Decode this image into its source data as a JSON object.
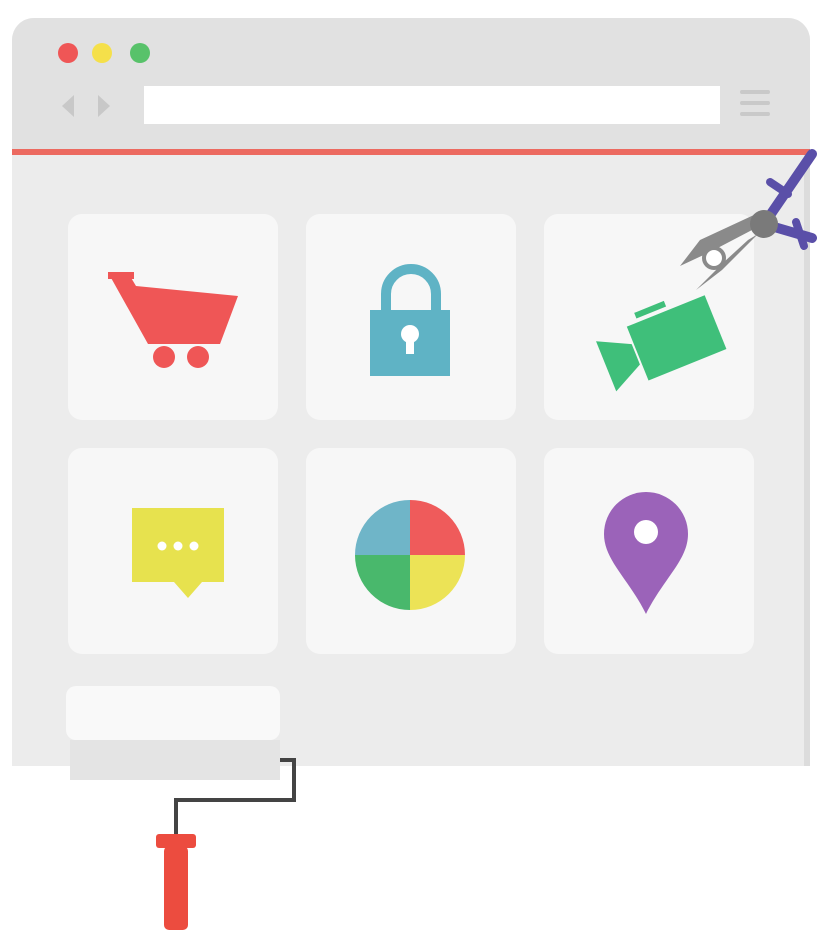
{
  "window": {
    "traffic_lights": [
      {
        "name": "close",
        "color": "#ef5656"
      },
      {
        "name": "minimize",
        "color": "#f5e04a"
      },
      {
        "name": "maximize",
        "color": "#58c26a"
      }
    ],
    "address_bar": {
      "value": "",
      "placeholder": ""
    },
    "accent_color": "#ec6a60"
  },
  "tiles": [
    {
      "icon": "shopping-cart-icon",
      "color": "#ef5656"
    },
    {
      "icon": "padlock-icon",
      "color": "#5fb3c5"
    },
    {
      "icon": "video-camera-icon",
      "color": "#3fbf7a"
    },
    {
      "icon": "chat-bubble-icon",
      "color": "#e7e24e"
    },
    {
      "icon": "pie-chart-icon",
      "colors": [
        "#6fb5c8",
        "#ef5b5b",
        "#49b86c",
        "#ece356"
      ]
    },
    {
      "icon": "map-pin-icon",
      "color": "#9b63b9"
    }
  ],
  "decorations": {
    "pliers": {
      "icon": "pliers-icon",
      "handle_color": "#5a4fa8",
      "jaw_color": "#8a8a8a"
    },
    "paint_roller": {
      "icon": "paint-roller-icon",
      "handle_color": "#ec4c3f",
      "roller_color": "#e4e4e4"
    }
  }
}
